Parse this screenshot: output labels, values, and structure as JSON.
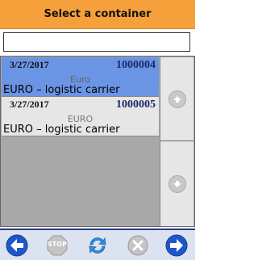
{
  "header": {
    "title": "Select a container"
  },
  "search": {
    "value": "",
    "placeholder": ""
  },
  "containers": [
    {
      "date": "3/27/2017",
      "number": "1000004",
      "type": "Euro",
      "name": "EURO – logistic carrier",
      "selected": true
    },
    {
      "date": "3/27/2017",
      "number": "1000005",
      "type": "EURO",
      "name": "EURO – logistic carrier",
      "selected": false
    }
  ],
  "scroll": {
    "up_icon": "arrow-up-icon",
    "down_icon": "arrow-down-icon"
  },
  "toolbar": {
    "back_icon": "arrow-left-icon",
    "stop_label": "STOP",
    "refresh_icon": "refresh-icon",
    "cancel_icon": "close-icon",
    "forward_icon": "arrow-right-icon"
  },
  "colors": {
    "header": "#f5a03a",
    "selected_row": "#6a94e4",
    "row": "#e6e6e6",
    "empty": "#a8a8a8",
    "nav_blue": "#1f57c8"
  }
}
